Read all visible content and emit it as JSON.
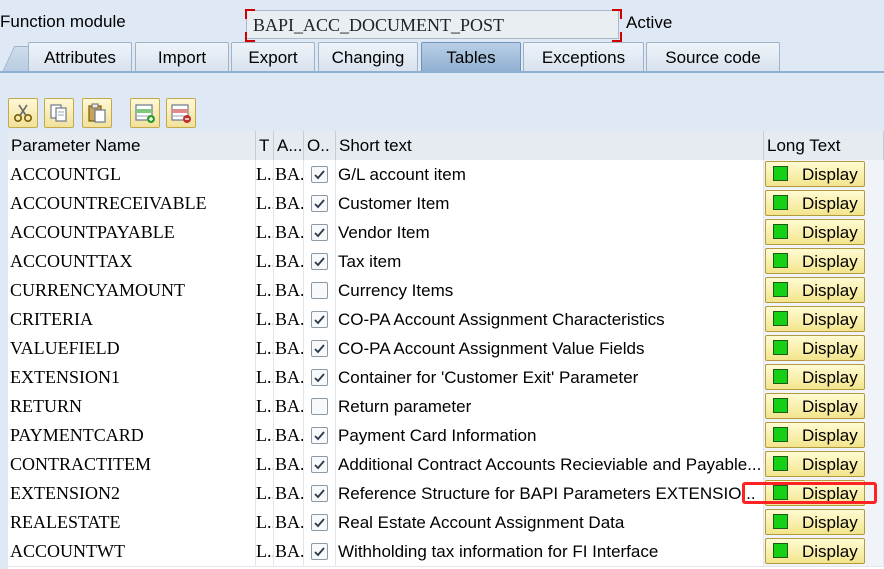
{
  "header": {
    "label": "Function module",
    "function_name": "BAPI_ACC_DOCUMENT_POST",
    "status": "Active"
  },
  "tabs": [
    {
      "label": "Attributes",
      "active": false
    },
    {
      "label": "Import",
      "active": false
    },
    {
      "label": "Export",
      "active": false
    },
    {
      "label": "Changing",
      "active": false
    },
    {
      "label": "Tables",
      "active": true
    },
    {
      "label": "Exceptions",
      "active": false
    },
    {
      "label": "Source code",
      "active": false
    }
  ],
  "toolbar": {
    "buttons": [
      "cut-icon",
      "copy-icon",
      "paste-icon",
      "insert-row-icon",
      "delete-row-icon"
    ]
  },
  "table": {
    "columns": {
      "name": "Parameter Name",
      "type": "T",
      "assoc": "A...",
      "optional": "O..",
      "short": "Short text",
      "long": "Long Text"
    },
    "display_label": "Display",
    "rows": [
      {
        "name": "ACCOUNTGL",
        "type": "L..",
        "assoc": "BA...",
        "optional": true,
        "short": "G/L account item"
      },
      {
        "name": "ACCOUNTRECEIVABLE",
        "type": "L..",
        "assoc": "BA...",
        "optional": true,
        "short": "Customer Item"
      },
      {
        "name": "ACCOUNTPAYABLE",
        "type": "L..",
        "assoc": "BA...",
        "optional": true,
        "short": "Vendor Item"
      },
      {
        "name": "ACCOUNTTAX",
        "type": "L..",
        "assoc": "BA...",
        "optional": true,
        "short": "Tax item"
      },
      {
        "name": "CURRENCYAMOUNT",
        "type": "L..",
        "assoc": "BA...",
        "optional": false,
        "short": "Currency Items"
      },
      {
        "name": "CRITERIA",
        "type": "L..",
        "assoc": "BA...",
        "optional": true,
        "short": "CO-PA Account Assignment Characteristics"
      },
      {
        "name": "VALUEFIELD",
        "type": "L..",
        "assoc": "BA...",
        "optional": true,
        "short": "CO-PA Account Assignment Value Fields"
      },
      {
        "name": "EXTENSION1",
        "type": "L..",
        "assoc": "BA...",
        "optional": true,
        "short": "Container for 'Customer Exit' Parameter"
      },
      {
        "name": "RETURN",
        "type": "L..",
        "assoc": "BA...",
        "optional": false,
        "short": "Return parameter"
      },
      {
        "name": "PAYMENTCARD",
        "type": "L..",
        "assoc": "BA...",
        "optional": true,
        "short": "Payment Card Information"
      },
      {
        "name": "CONTRACTITEM",
        "type": "L..",
        "assoc": "BA...",
        "optional": true,
        "short": "Additional Contract Accounts Recieviable and Payable..."
      },
      {
        "name": "EXTENSION2",
        "type": "L..",
        "assoc": "BA...",
        "optional": true,
        "short": "Reference Structure for BAPI Parameters EXTENSIO..."
      },
      {
        "name": "REALESTATE",
        "type": "L..",
        "assoc": "BA...",
        "optional": true,
        "short": "Real Estate Account Assignment Data"
      },
      {
        "name": "ACCOUNTWT",
        "type": "L..",
        "assoc": "BA...",
        "optional": true,
        "short": "Withholding tax information for FI Interface"
      }
    ]
  },
  "colors": {
    "highlight": "#ff2222",
    "active_tab": "#8fb0d2",
    "display_led": "#16d016"
  }
}
